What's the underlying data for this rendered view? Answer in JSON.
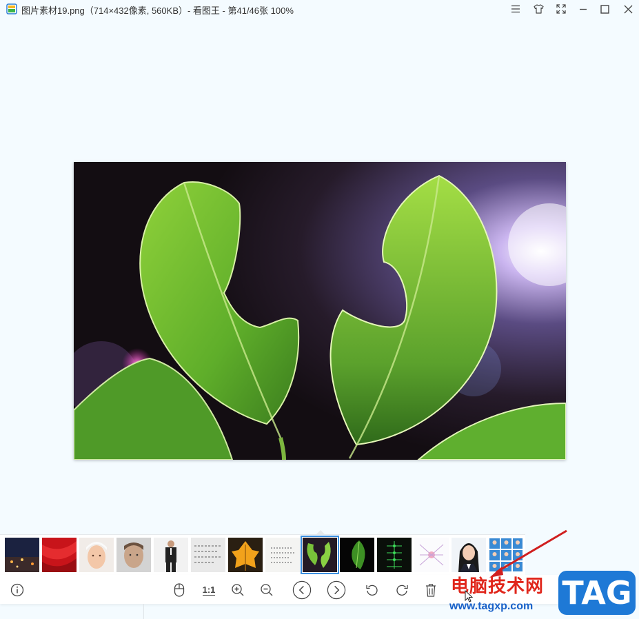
{
  "window": {
    "title": "图片素材19.png（714×432像素, 560KB）- 看图王 - 第41/46张 100%",
    "controls": [
      "menu-icon",
      "skin-icon",
      "fullscreen-icon",
      "minimize-icon",
      "maximize-icon",
      "close-icon"
    ]
  },
  "thumbnails": [
    {
      "name": "night-city"
    },
    {
      "name": "red-curtain"
    },
    {
      "name": "woman-skincare"
    },
    {
      "name": "man-portrait"
    },
    {
      "name": "businessman"
    },
    {
      "name": "handwritten-note"
    },
    {
      "name": "yellow-leaf"
    },
    {
      "name": "handwriting-paper"
    },
    {
      "name": "green-leaves",
      "selected": true
    },
    {
      "name": "leaf-on-black"
    },
    {
      "name": "green-diagram"
    },
    {
      "name": "mind-map"
    },
    {
      "name": "id-photo"
    },
    {
      "name": "id-photo-grid"
    }
  ],
  "toolbar": {
    "actual_size_label": "1:1",
    "buttons": [
      "info-icon",
      "mouse-icon",
      "actual-size-button",
      "zoom-in-icon",
      "zoom-out-icon",
      "previous-icon",
      "next-icon",
      "rotate-left-icon",
      "rotate-right-icon",
      "delete-icon"
    ]
  },
  "watermark": {
    "site_name": "电脑技术网",
    "url": "www.tagxp.com",
    "badge": "TAG"
  },
  "colors": {
    "background": "#f4fbff",
    "selection": "#3b8fe0",
    "watermark_red": "#e0261b",
    "watermark_blue": "#1e79d6"
  }
}
